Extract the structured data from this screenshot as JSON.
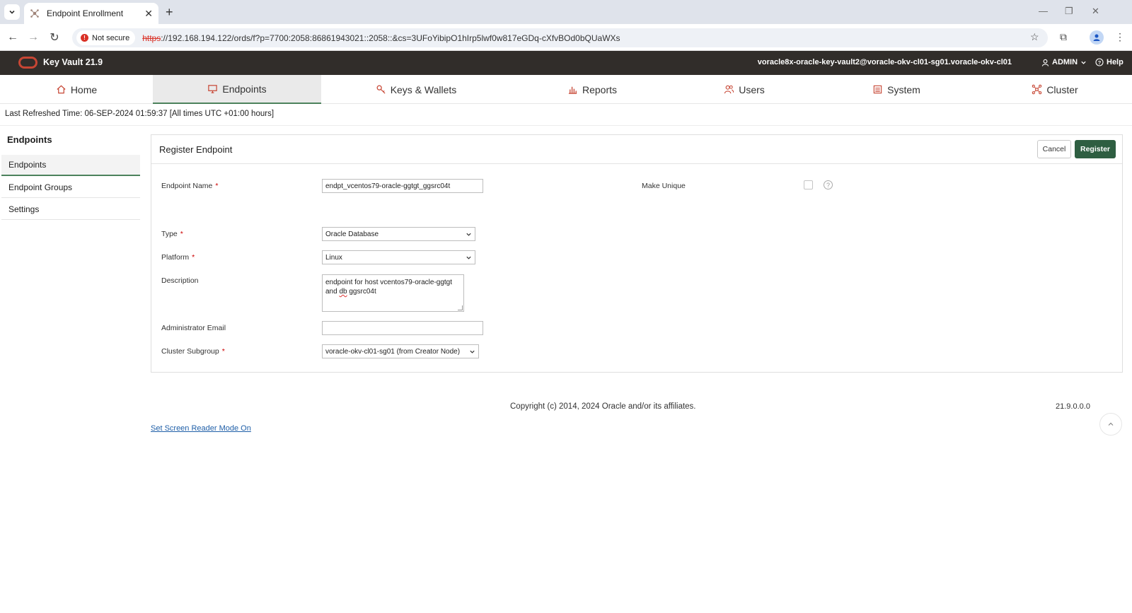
{
  "browser": {
    "tab_title": "Endpoint Enrollment",
    "new_tab": "+",
    "security_label": "Not secure",
    "url_scheme": "https",
    "url_rest": "://192.168.194.122/ords/f?p=7700:2058:86861943021::2058::&cs=3UFoYibipO1hIrp5lwf0w817eGDq-cXfvBOd0bQUaWXs"
  },
  "app": {
    "title": "Key Vault 21.9",
    "hostname": "voracle8x-oracle-key-vault2@voracle-okv-cl01-sg01.voracle-okv-cl01",
    "user_menu": "ADMIN",
    "help": "Help",
    "brand_color": "#c74634",
    "accent_color": "#4c825c",
    "header_color": "#312d2a"
  },
  "nav": {
    "home": "Home",
    "endpoints": "Endpoints",
    "keys_wallets": "Keys & Wallets",
    "reports": "Reports",
    "users": "Users",
    "system": "System",
    "cluster": "Cluster",
    "active": "Endpoints"
  },
  "refresh_text": "Last Refreshed Time: 06-SEP-2024 01:59:37 [All times UTC +01:00 hours]",
  "sidebar": {
    "heading": "Endpoints",
    "items": [
      {
        "label": "Endpoints"
      },
      {
        "label": "Endpoint Groups"
      },
      {
        "label": "Settings"
      }
    ]
  },
  "form": {
    "title": "Register Endpoint",
    "cancel_label": "Cancel",
    "register_label": "Register",
    "endpoint_name_label": "Endpoint Name",
    "endpoint_name_value": "endpt_vcentos79-oracle-ggtgt_ggsrc04t",
    "make_unique_label": "Make Unique",
    "make_unique_checked": false,
    "help_glyph": "?",
    "required_mark": "*",
    "type_label": "Type",
    "type_value": "Oracle Database",
    "platform_label": "Platform",
    "platform_value": "Linux",
    "description_label": "Description",
    "description_line1": "endpoint for host vcentos79-oracle-ggtgt",
    "description_line2_a": "and ",
    "description_line2_b": "db",
    "description_line2_c": " ggsrc04t",
    "admin_email_label": "Administrator Email",
    "admin_email_value": "",
    "cluster_subgroup_label": "Cluster Subgroup",
    "cluster_subgroup_value": "voracle-okv-cl01-sg01 (from Creator Node)"
  },
  "footer": {
    "copyright": "Copyright (c) 2014, 2024 Oracle and/or its affiliates.",
    "version": "21.9.0.0.0",
    "screen_reader_link": "Set Screen Reader Mode On"
  }
}
